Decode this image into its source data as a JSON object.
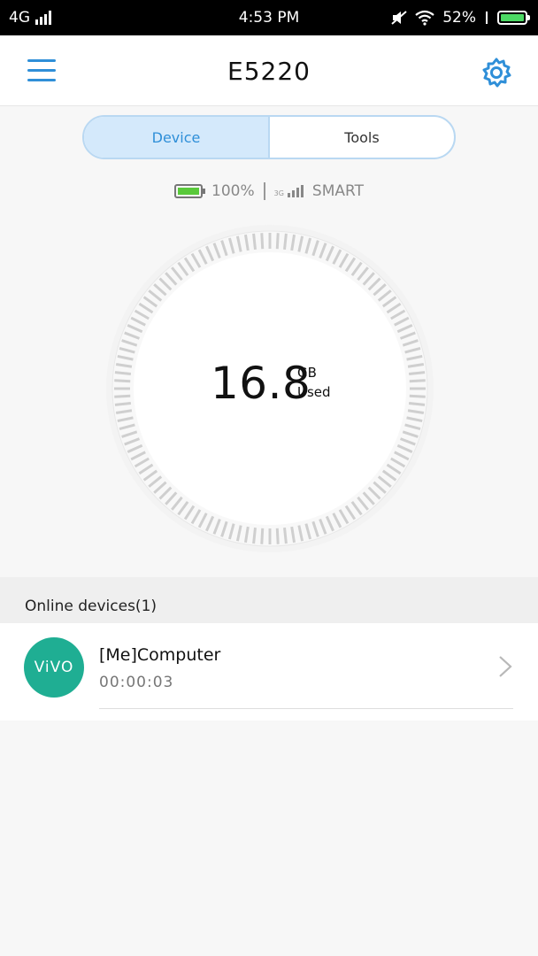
{
  "status_bar": {
    "network": "4G",
    "time": "4:53 PM",
    "battery_percent": "52%"
  },
  "header": {
    "title": "E5220",
    "menu_icon": "hamburger-menu-icon",
    "settings_icon": "gear-icon"
  },
  "tabs": [
    {
      "label": "Device",
      "active": true
    },
    {
      "label": "Tools",
      "active": false
    }
  ],
  "device_info": {
    "battery": "100%",
    "network_type": "3G",
    "carrier": "SMART"
  },
  "usage": {
    "value": "16.8",
    "unit": "GB",
    "label": "Used"
  },
  "online_devices": {
    "title": "Online devices(1)",
    "items": [
      {
        "avatar_text": "ViVO",
        "name": "[Me]Computer",
        "duration": "00:00:03"
      }
    ]
  },
  "colors": {
    "accent": "#2f8fd8",
    "avatar": "#1fae93",
    "battery_fill": "#59c93a"
  }
}
